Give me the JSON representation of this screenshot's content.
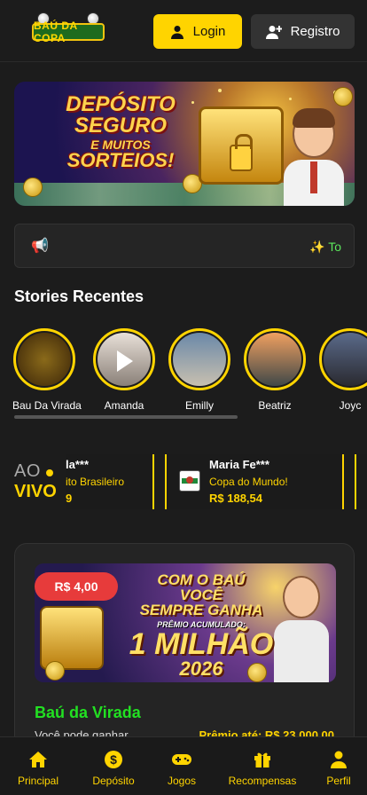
{
  "header": {
    "logo_text": "BAÚ DA COPA",
    "login_label": "Login",
    "register_label": "Registro"
  },
  "banner": {
    "line1": "DEPÓSITO",
    "line2": "SEGURO",
    "line3": "E MUITOS",
    "line4": "SORTEIOS!"
  },
  "marquee": {
    "text": "✨ To"
  },
  "stories": {
    "title": "Stories Recentes",
    "items": [
      {
        "name": "Bau Da Virada"
      },
      {
        "name": "Amanda"
      },
      {
        "name": "Emilly"
      },
      {
        "name": "Beatriz"
      },
      {
        "name": "Joyc"
      }
    ]
  },
  "live": {
    "ao": "AO",
    "vivo": "VIVO",
    "wins": [
      {
        "who": "la***",
        "game": "ito Brasileiro",
        "amount": "9"
      },
      {
        "who": "Maria Fe***",
        "game": "Copa do Mundo!",
        "amount": "R$ 188,54"
      }
    ]
  },
  "product": {
    "price": "R$ 4,00",
    "banner_line1": "COM O BAÚ",
    "banner_line2": "VOCÊ",
    "banner_line3": "SEMPRE GANHA",
    "banner_line4": "PRÊMIO ACUMULADO:",
    "banner_line5": "1 MILHÃO",
    "banner_line6": "2026",
    "title": "Baú da Virada",
    "description": "Você pode ganhar",
    "prize": "Prêmio até: R$ 23.000,00"
  },
  "nav": {
    "items": [
      {
        "label": "Principal",
        "icon": "home-icon"
      },
      {
        "label": "Depósito",
        "icon": "dollar-coin-icon"
      },
      {
        "label": "Jogos",
        "icon": "gamepad-icon"
      },
      {
        "label": "Recompensas",
        "icon": "gift-icon"
      },
      {
        "label": "Perfil",
        "icon": "user-icon"
      }
    ]
  },
  "colors": {
    "accent": "#ffd400",
    "background": "#1c1c1c",
    "highlight_green": "#22e022",
    "badge_red": "#e73b3b"
  }
}
